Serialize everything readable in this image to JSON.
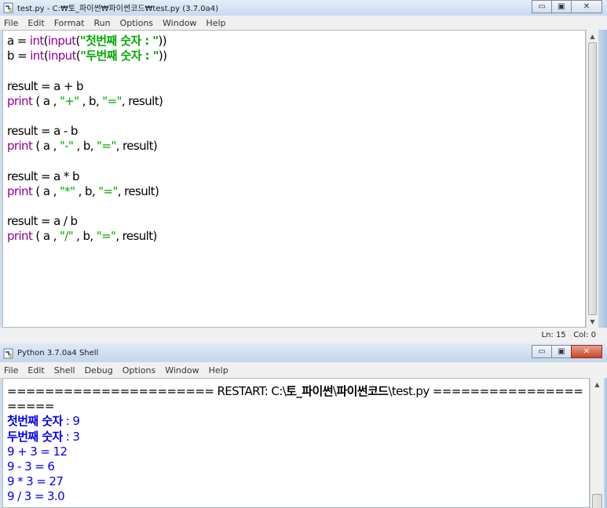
{
  "editor": {
    "title": "test.py - C:₩토_파이썬₩파이썬코드₩test.py (3.7.0a4)",
    "menus": [
      "File",
      "Edit",
      "Format",
      "Run",
      "Options",
      "Window",
      "Help"
    ],
    "code": {
      "l1": {
        "a": "a = ",
        "b": "int",
        "c": "(",
        "d": "input",
        "e": "(",
        "f": "\"첫번째 숫자 : \"",
        "g": "))"
      },
      "l2": {
        "a": "b = ",
        "b": "int",
        "c": "(",
        "d": "input",
        "e": "(",
        "f": "\"두번째 숫자 : \"",
        "g": "))"
      },
      "l4": "result = a + b",
      "l5": {
        "a": "print",
        "b": " ( a , ",
        "c": "\"+\"",
        "d": " , b, ",
        "e": "\"=\"",
        "f": ", result)"
      },
      "l7": "result = a - b",
      "l8": {
        "a": "print",
        "b": " ( a , ",
        "c": "\"-\"",
        "d": " , b, ",
        "e": "\"=\"",
        "f": ", result)"
      },
      "l10": "result = a * b",
      "l11": {
        "a": "print",
        "b": " ( a , ",
        "c": "\"*\"",
        "d": " , b, ",
        "e": "\"=\"",
        "f": ", result)"
      },
      "l13": "result = a / b",
      "l14": {
        "a": "print",
        "b": " ( a , ",
        "c": "\"/\"",
        "d": " , b, ",
        "e": "\"=\"",
        "f": ", result)"
      }
    },
    "status": "Ln: 15   Col: 0"
  },
  "shell": {
    "title": "Python 3.7.0a4 Shell",
    "menus": [
      "File",
      "Edit",
      "Shell",
      "Debug",
      "Options",
      "Window",
      "Help"
    ],
    "output": {
      "restart_a": "====================== RESTART: C:\\",
      "restart_b": "토_파이썬",
      "restart_c": "\\",
      "restart_d": "파이썬코드",
      "restart_e": "\\test.py ================",
      "restart_wrap": "=====",
      "p1_label": "첫번째 숫자",
      "p1_rest": " : 9",
      "p2_label": "두번째 숫자",
      "p2_rest": " : 3",
      "r1": "9 + 3 = 12",
      "r2": "9 - 3 = 6",
      "r3": "9 * 3 = 27",
      "r4": "9 / 3 = 3.0"
    }
  },
  "colors": {
    "keyword": "#900090",
    "string": "#00aa00",
    "output": "#0000ee"
  }
}
